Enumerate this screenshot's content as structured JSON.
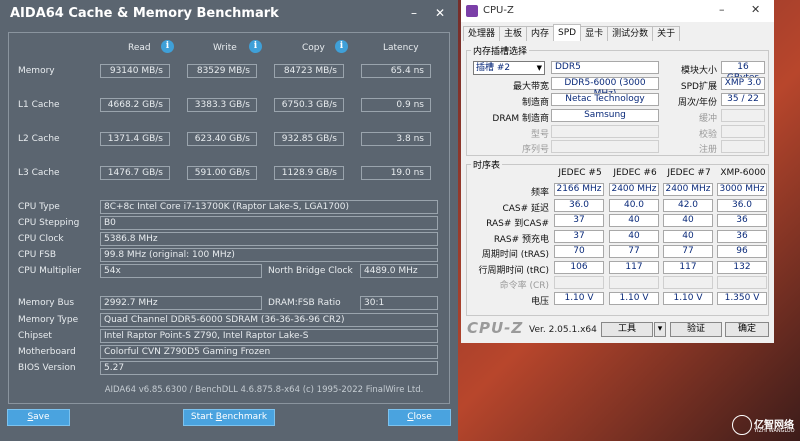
{
  "aida": {
    "title": "AIDA64 Cache & Memory Benchmark",
    "minimize": "–",
    "close": "✕",
    "columns": [
      "Read",
      "Write",
      "Copy",
      "Latency"
    ],
    "rows": [
      {
        "label": "Memory",
        "values": [
          "93140 MB/s",
          "83529 MB/s",
          "84723 MB/s",
          "65.4 ns"
        ]
      },
      {
        "label": "L1 Cache",
        "values": [
          "4668.2 GB/s",
          "3383.3 GB/s",
          "6750.3 GB/s",
          "0.9 ns"
        ]
      },
      {
        "label": "L2 Cache",
        "values": [
          "1371.4 GB/s",
          "623.40 GB/s",
          "932.85 GB/s",
          "3.8 ns"
        ]
      },
      {
        "label": "L3 Cache",
        "values": [
          "1476.7 GB/s",
          "591.00 GB/s",
          "1128.9 GB/s",
          "19.0 ns"
        ]
      }
    ],
    "info": {
      "cpu_type_label": "CPU Type",
      "cpu_type": "8C+8c Intel Core i7-13700K  (Raptor Lake-S, LGA1700)",
      "cpu_stepping_label": "CPU Stepping",
      "cpu_stepping": "B0",
      "cpu_clock_label": "CPU Clock",
      "cpu_clock": "5386.8 MHz",
      "cpu_fsb_label": "CPU FSB",
      "cpu_fsb": "99.8 MHz  (original: 100 MHz)",
      "cpu_mult_label": "CPU Multiplier",
      "cpu_mult": "54x",
      "nb_clock_label": "North Bridge Clock",
      "nb_clock": "4489.0 MHz",
      "mem_bus_label": "Memory Bus",
      "mem_bus": "2992.7 MHz",
      "dram_fsb_label": "DRAM:FSB Ratio",
      "dram_fsb": "30:1",
      "mem_type_label": "Memory Type",
      "mem_type": "Quad Channel DDR5-6000 SDRAM  (36-36-36-96 CR2)",
      "chipset_label": "Chipset",
      "chipset": "Intel Raptor Point-S Z790, Intel Raptor Lake-S",
      "mobo_label": "Motherboard",
      "mobo": "Colorful CVN Z790D5 Gaming Frozen",
      "bios_label": "BIOS Version",
      "bios": "5.27"
    },
    "footer": "AIDA64 v6.85.6300 / BenchDLL 4.6.875.8-x64  (c) 1995-2022 FinalWire Ltd.",
    "buttons": {
      "save_first": "S",
      "save_rest": "ave",
      "start": "Start ",
      "start_u": "B",
      "start_rest": "enchmark",
      "close_first": "C",
      "close_rest": "lose"
    }
  },
  "cpuz": {
    "title": "CPU-Z",
    "minimize": "–",
    "close": "✕",
    "tabs": [
      "处理器",
      "主板",
      "内存",
      "SPD",
      "显卡",
      "测试分数",
      "关于"
    ],
    "slot_group": "内存插槽选择",
    "slot_select": "插槽 #2",
    "type": "DDR5",
    "max_bw_label": "最大带宽",
    "max_bw": "DDR5-6000 (3000 MHz)",
    "mfr_label": "制造商",
    "mfr": "Netac Technology",
    "dram_mfr_label": "DRAM 制造商",
    "dram_mfr": "Samsung",
    "model_label": "型号",
    "serial_label": "序列号",
    "module_size_label": "模块大小",
    "module_size": "16 GBytes",
    "spd_ext_label": "SPD扩展",
    "spd_ext": "XMP 3.0",
    "week_year_label": "周次/年份",
    "week_year": "35 / 22",
    "buffer_label": "缓冲",
    "check_label": "校验",
    "reg_label": "注册",
    "timing_group": "时序表",
    "timing_cols": [
      "JEDEC #5",
      "JEDEC #6",
      "JEDEC #7",
      "XMP-6000"
    ],
    "timing_rows": [
      {
        "label": "频率",
        "values": [
          "2166 MHz",
          "2400 MHz",
          "2400 MHz",
          "3000 MHz"
        ]
      },
      {
        "label": "CAS# 延迟",
        "values": [
          "36.0",
          "40.0",
          "42.0",
          "36.0"
        ]
      },
      {
        "label": "RAS# 到CAS#",
        "values": [
          "37",
          "40",
          "40",
          "36"
        ]
      },
      {
        "label": "RAS# 预充电",
        "values": [
          "37",
          "40",
          "40",
          "36"
        ]
      },
      {
        "label": "周期时间 (tRAS)",
        "values": [
          "70",
          "77",
          "77",
          "96"
        ]
      },
      {
        "label": "行周期时间 (tRC)",
        "values": [
          "106",
          "117",
          "117",
          "132"
        ]
      },
      {
        "label": "命令率 (CR)",
        "values": [
          "",
          "",
          "",
          ""
        ]
      },
      {
        "label": "电压",
        "values": [
          "1.10 V",
          "1.10 V",
          "1.10 V",
          "1.350 V"
        ]
      }
    ],
    "logo": "CPU-Z",
    "version": "Ver. 2.05.1.x64",
    "tools": "工具",
    "validate": "验证",
    "ok": "确定"
  },
  "watermark": {
    "text": "亿智网络",
    "sub": "YIZHI WANGLUO"
  }
}
